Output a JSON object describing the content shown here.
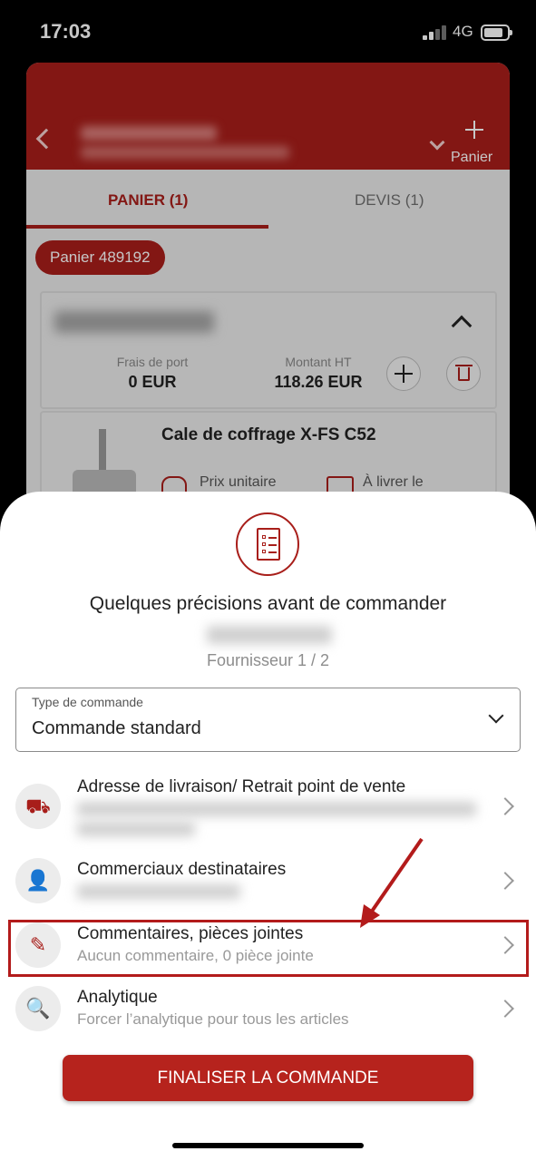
{
  "status_bar": {
    "time": "17:03",
    "network": "4G"
  },
  "header": {
    "add_label": "Panier"
  },
  "tabs": [
    {
      "label": "PANIER (1)"
    },
    {
      "label": "DEVIS (1)"
    }
  ],
  "cart_chip": "Panier 489192",
  "supplier_card": {
    "shipping_label": "Frais de port",
    "shipping_value": "0 EUR",
    "amount_label": "Montant HT",
    "amount_value": "118.26 EUR"
  },
  "product": {
    "title": "Cale de coffrage X-FS C52",
    "unit_price_label": "Prix unitaire",
    "delivery_label": "À livrer le"
  },
  "sheet": {
    "title": "Quelques précisions avant de commander",
    "supplier_counter": "Fournisseur 1 / 2",
    "order_type": {
      "label": "Type de commande",
      "value": "Commande standard"
    },
    "rows": [
      {
        "title": "Adresse de livraison/ Retrait point de vente",
        "icon": "truck-icon"
      },
      {
        "title": "Commerciaux destinataires",
        "icon": "salesperson-icon"
      },
      {
        "title": "Commentaires, pièces jointes",
        "subtitle": "Aucun commentaire, 0 pièce jointe",
        "icon": "edit-icon"
      },
      {
        "title": "Analytique",
        "subtitle": "Forcer l’analytique pour tous les articles",
        "icon": "analytics-icon"
      }
    ],
    "finalize_label": "FINALISER LA COMMANDE"
  },
  "colors": {
    "brand": "#a81e1a",
    "highlight": "#b31b1b"
  }
}
